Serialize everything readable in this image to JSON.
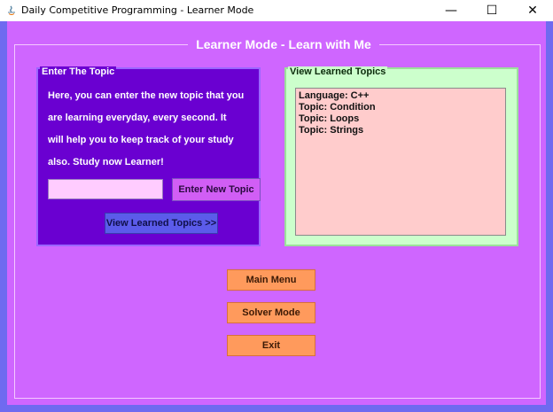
{
  "window": {
    "title": "Daily Competitive Programming - Learner Mode",
    "controls": {
      "minimize": "—",
      "maximize": "☐",
      "close": "✕"
    }
  },
  "header": {
    "title": "Learner Mode - Learn with Me"
  },
  "left_panel": {
    "title": "Enter The Topic",
    "info_lines": [
      "Here, you can enter the new topic that you",
      "are learning everyday, every second. It",
      "will help you to keep track of your study",
      "also. Study now Learner!"
    ],
    "topic_input_value": "",
    "enter_button_label": "Enter New Topic",
    "view_button_label": "View Learned Topics >>"
  },
  "right_panel": {
    "title": "View Learned Topics",
    "topics": [
      "Language: C++",
      "Topic: Condition",
      "Topic: Loops",
      "Topic: Strings"
    ]
  },
  "actions": {
    "main_menu_label": "Main Menu",
    "solver_mode_label": "Solver Mode",
    "exit_label": "Exit"
  },
  "colors": {
    "frame_bg": "#6f6af0",
    "content_bg": "#cf66ff",
    "left_panel_bg": "#6a00d1",
    "right_panel_bg": "#ccffcc",
    "list_bg": "#ffcccc",
    "input_bg": "#ffccff",
    "action_button_bg": "#ff9a5c"
  }
}
